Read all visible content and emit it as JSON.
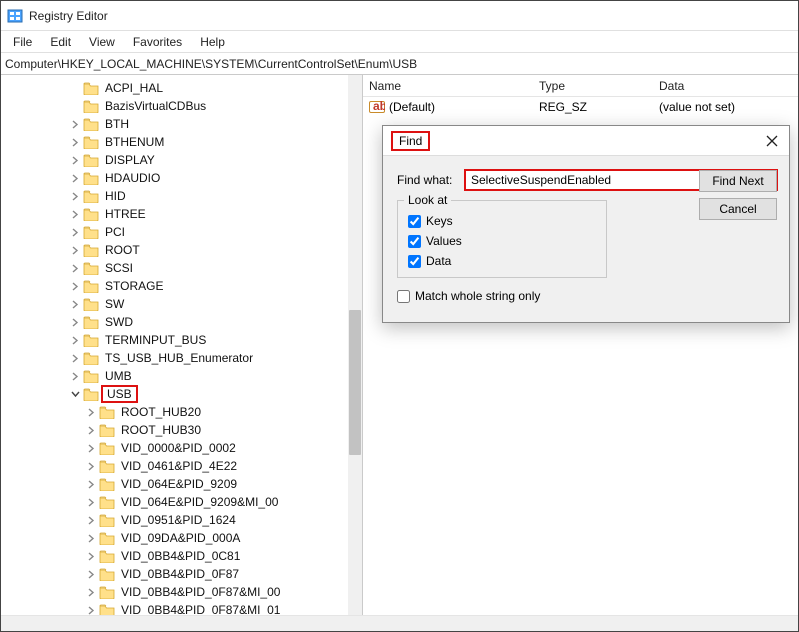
{
  "window": {
    "title": "Registry Editor"
  },
  "menu": {
    "file": "File",
    "edit": "Edit",
    "view": "View",
    "favorites": "Favorites",
    "help": "Help"
  },
  "address": "Computer\\HKEY_LOCAL_MACHINE\\SYSTEM\\CurrentControlSet\\Enum\\USB",
  "tree": {
    "items": [
      {
        "indent": "a",
        "exp": "blank",
        "label": "ACPI_HAL"
      },
      {
        "indent": "a",
        "exp": "blank",
        "label": "BazisVirtualCDBus"
      },
      {
        "indent": "a",
        "exp": "right",
        "label": "BTH"
      },
      {
        "indent": "a",
        "exp": "right",
        "label": "BTHENUM"
      },
      {
        "indent": "a",
        "exp": "right",
        "label": "DISPLAY"
      },
      {
        "indent": "a",
        "exp": "right",
        "label": "HDAUDIO"
      },
      {
        "indent": "a",
        "exp": "right",
        "label": "HID"
      },
      {
        "indent": "a",
        "exp": "right",
        "label": "HTREE"
      },
      {
        "indent": "a",
        "exp": "right",
        "label": "PCI"
      },
      {
        "indent": "a",
        "exp": "right",
        "label": "ROOT"
      },
      {
        "indent": "a",
        "exp": "right",
        "label": "SCSI"
      },
      {
        "indent": "a",
        "exp": "right",
        "label": "STORAGE"
      },
      {
        "indent": "a",
        "exp": "right",
        "label": "SW"
      },
      {
        "indent": "a",
        "exp": "right",
        "label": "SWD"
      },
      {
        "indent": "a",
        "exp": "right",
        "label": "TERMINPUT_BUS"
      },
      {
        "indent": "a",
        "exp": "right",
        "label": "TS_USB_HUB_Enumerator"
      },
      {
        "indent": "a",
        "exp": "right",
        "label": "UMB"
      },
      {
        "indent": "a",
        "exp": "down",
        "label": "USB",
        "selected": true
      },
      {
        "indent": "b",
        "exp": "right",
        "label": "ROOT_HUB20"
      },
      {
        "indent": "b",
        "exp": "right",
        "label": "ROOT_HUB30"
      },
      {
        "indent": "b",
        "exp": "right",
        "label": "VID_0000&PID_0002"
      },
      {
        "indent": "b",
        "exp": "right",
        "label": "VID_0461&PID_4E22"
      },
      {
        "indent": "b",
        "exp": "right",
        "label": "VID_064E&PID_9209"
      },
      {
        "indent": "b",
        "exp": "right",
        "label": "VID_064E&PID_9209&MI_00"
      },
      {
        "indent": "b",
        "exp": "right",
        "label": "VID_0951&PID_1624"
      },
      {
        "indent": "b",
        "exp": "right",
        "label": "VID_09DA&PID_000A"
      },
      {
        "indent": "b",
        "exp": "right",
        "label": "VID_0BB4&PID_0C81"
      },
      {
        "indent": "b",
        "exp": "right",
        "label": "VID_0BB4&PID_0F87"
      },
      {
        "indent": "b",
        "exp": "right",
        "label": "VID_0BB4&PID_0F87&MI_00"
      },
      {
        "indent": "b",
        "exp": "right",
        "label": "VID_0BB4&PID_0F87&MI_01"
      }
    ]
  },
  "list": {
    "header": {
      "name": "Name",
      "type": "Type",
      "data": "Data"
    },
    "rows": [
      {
        "name": "(Default)",
        "type": "REG_SZ",
        "data": "(value not set)"
      }
    ]
  },
  "find": {
    "title": "Find",
    "what_label": "Find what:",
    "what_value": "SelectiveSuspendEnabled",
    "lookat_label": "Look at",
    "keys": "Keys",
    "values": "Values",
    "data": "Data",
    "match_whole": "Match whole string only",
    "find_next": "Find Next",
    "cancel": "Cancel"
  },
  "icons": {
    "folder_fill": "#ffe08a",
    "folder_stroke": "#d6a830"
  }
}
